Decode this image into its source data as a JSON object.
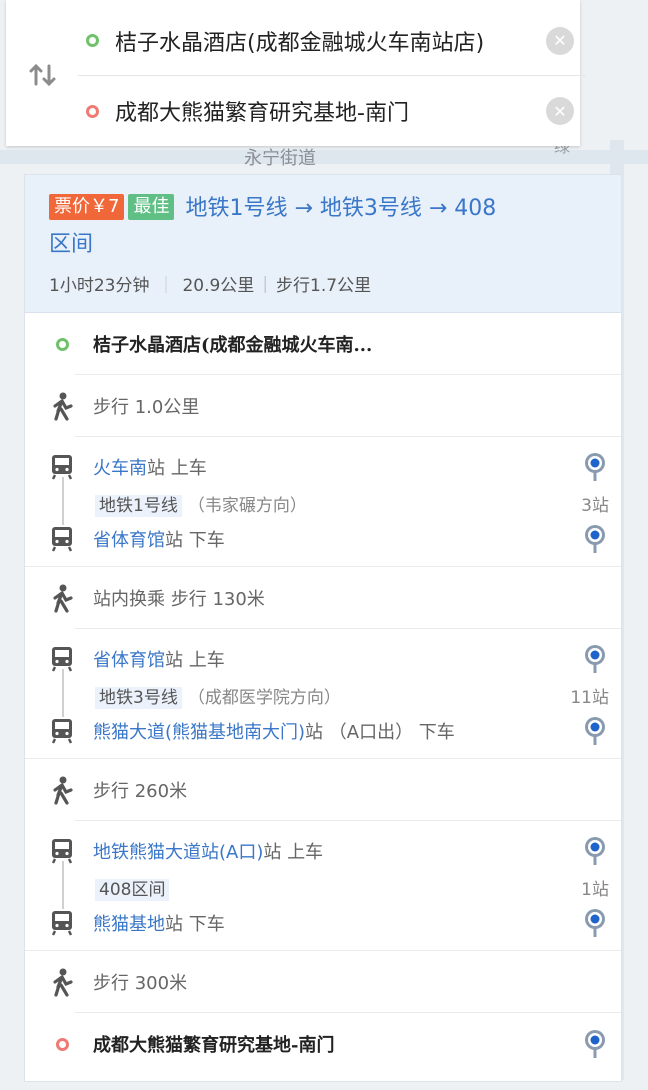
{
  "map": {
    "label_street": "永宁街道",
    "label_right": "绿"
  },
  "search": {
    "from": "桔子水晶酒店(成都金融城火车南站店)",
    "to": "成都大熊猫繁育研究基地-南门",
    "swap_icon": "swap-vertical-icon",
    "clear_icon": "close-circle-icon"
  },
  "route": {
    "price_badge": "票价￥7",
    "best_badge": "最佳",
    "title_line1": "地铁1号线 → 地铁3号线 → 408",
    "title_line2": "区间",
    "duration": "1小时23分钟",
    "distance": "20.9公里",
    "walk": "步行1.7公里"
  },
  "steps": {
    "start": "桔子水晶酒店(成都金融城火车南...",
    "walk1": "步行  1.0公里",
    "seg1": {
      "board_station": "火车南",
      "board_suffix": "站  上车",
      "line": "地铁1号线",
      "direction": "（韦家碾方向）",
      "stops": "3站",
      "alight_station": "省体育馆",
      "alight_suffix": "站 下车"
    },
    "transfer": "站内换乘 步行  130米",
    "seg2": {
      "board_station": "省体育馆",
      "board_suffix": "站  上车",
      "line": "地铁3号线",
      "direction": "（成都医学院方向）",
      "stops": "11站",
      "alight_station": "熊猫大道(熊猫基地南大门)",
      "alight_suffix": "站 （A口出） 下车"
    },
    "walk2": "步行  260米",
    "seg3": {
      "board_station": "地铁熊猫大道站(A口)",
      "board_suffix": "站  上车",
      "line": "408区间",
      "stops": "1站",
      "alight_station": "熊猫基地",
      "alight_suffix": "站 下车"
    },
    "walk3": "步行  300米",
    "end": "成都大熊猫繁育研究基地-南门"
  },
  "colors": {
    "accent": "#3a77c8",
    "price": "#f0673a",
    "best": "#5fbf85",
    "start_dot": "#6fc26a",
    "end_dot": "#ee7a73"
  }
}
